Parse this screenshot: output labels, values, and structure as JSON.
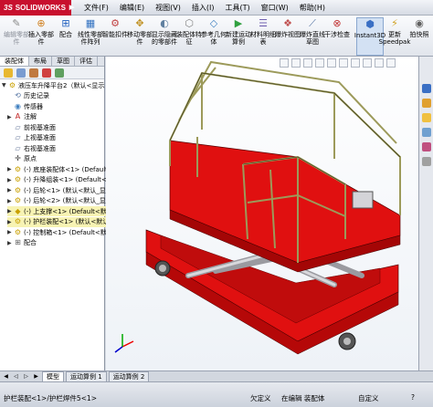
{
  "app": {
    "logo_text": "SOLIDWORKS",
    "logo_prefix": "3S"
  },
  "menu": [
    "文件(F)",
    "编辑(E)",
    "视图(V)",
    "插入(I)",
    "工具(T)",
    "窗口(W)",
    "帮助(H)"
  ],
  "commands": [
    {
      "label": "编辑零部件",
      "icon": "edit-component-icon",
      "disabled": true
    },
    {
      "label": "插入零部件",
      "icon": "insert-component-icon"
    },
    {
      "label": "配合",
      "icon": "mate-icon"
    },
    {
      "label": "线性零部件阵列",
      "icon": "linear-pattern-icon"
    },
    {
      "label": "智能扣件",
      "icon": "smart-fastener-icon"
    },
    {
      "label": "移动零部件",
      "icon": "move-component-icon"
    },
    {
      "label": "显示隐藏的零部件",
      "icon": "show-hidden-icon"
    },
    {
      "label": "装配体特征",
      "icon": "assembly-feature-icon"
    },
    {
      "label": "参考几何体",
      "icon": "reference-geometry-icon"
    },
    {
      "label": "新建运动算例",
      "icon": "new-motion-study-icon"
    },
    {
      "label": "材料明细表",
      "icon": "bom-icon"
    },
    {
      "label": "爆炸视图",
      "icon": "exploded-view-icon"
    },
    {
      "label": "爆炸直线草图",
      "icon": "explode-line-sketch-icon"
    },
    {
      "label": "干涉检查",
      "icon": "interference-check-icon"
    },
    {
      "label": "Instant3D",
      "icon": "instant3d-icon",
      "active": true
    },
    {
      "label": "更新Speedpak",
      "icon": "speedpak-icon"
    },
    {
      "label": "拍快照",
      "icon": "snapshot-icon"
    }
  ],
  "panel_tabs": [
    "装配体",
    "布局",
    "草图",
    "评估"
  ],
  "tree": [
    {
      "label": "液压车升降平台2（默认<显示",
      "icon": "assembly-icon",
      "level": 0,
      "expander": "▼"
    },
    {
      "label": "历史记录",
      "icon": "history-icon",
      "level": 1,
      "expander": ""
    },
    {
      "label": "传感器",
      "icon": "sensor-icon",
      "level": 1,
      "expander": ""
    },
    {
      "label": "注解",
      "icon": "annotation-icon",
      "level": 1,
      "expander": "▶"
    },
    {
      "label": "前视基准面",
      "icon": "plane-icon",
      "level": 1,
      "expander": ""
    },
    {
      "label": "上视基准面",
      "icon": "plane-icon",
      "level": 1,
      "expander": ""
    },
    {
      "label": "右视基准面",
      "icon": "plane-icon",
      "level": 1,
      "expander": ""
    },
    {
      "label": "原点",
      "icon": "origin-icon",
      "level": 1,
      "expander": ""
    },
    {
      "label": "(-) 底座装配体<1> (Default<默",
      "icon": "assembly-icon",
      "level": 1,
      "expander": "▶"
    },
    {
      "label": "(-) 升降组装<1> (Default<默认",
      "icon": "assembly-icon",
      "level": 1,
      "expander": "▶"
    },
    {
      "label": "(-) 后轮<1> (默认<默认_显...",
      "icon": "assembly-icon",
      "level": 1,
      "expander": "▶"
    },
    {
      "label": "(-) 后轮<2> (默认<默认_显...",
      "icon": "assembly-icon",
      "level": 1,
      "expander": "▶"
    },
    {
      "label": "(-) 上支撑<1> (Default<默认",
      "icon": "part-icon",
      "level": 1,
      "expander": "▶",
      "selected": true
    },
    {
      "label": "(-) 护栏装配<1> (默认<默认",
      "icon": "assembly-icon",
      "level": 1,
      "expander": "▶",
      "selected": true
    },
    {
      "label": "(-) 控制箱<1> (Default<默认",
      "icon": "assembly-icon",
      "level": 1,
      "expander": "▶"
    },
    {
      "label": "配合",
      "icon": "mates-icon",
      "level": 1,
      "expander": "▶"
    }
  ],
  "bottom_tabs": [
    "模型",
    "运动算例 1",
    "运动算例 2"
  ],
  "status": {
    "left": "护栏装配<1>/护栏焊件5<1>",
    "mid1": "欠定义",
    "mid2": "在编辑 装配体",
    "mid3": "自定义"
  },
  "colors": {
    "platform_red": "#e01010",
    "frame_olive": "#b0ad6a",
    "scissor_gray": "#c8c8cc"
  }
}
